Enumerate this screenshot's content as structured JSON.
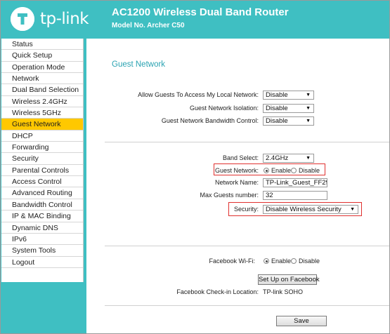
{
  "header": {
    "logo_text": "tp-link",
    "title": "AC1200 Wireless Dual Band Router",
    "model": "Model No. Archer C50"
  },
  "sidebar": {
    "items": [
      {
        "label": "Status"
      },
      {
        "label": "Quick Setup"
      },
      {
        "label": "Operation Mode"
      },
      {
        "label": "Network"
      },
      {
        "label": "Dual Band Selection"
      },
      {
        "label": "Wireless 2.4GHz"
      },
      {
        "label": "Wireless 5GHz"
      },
      {
        "label": "Guest Network",
        "active": true
      },
      {
        "label": "DHCP"
      },
      {
        "label": "Forwarding"
      },
      {
        "label": "Security"
      },
      {
        "label": "Parental Controls"
      },
      {
        "label": "Access Control"
      },
      {
        "label": "Advanced Routing"
      },
      {
        "label": "Bandwidth Control"
      },
      {
        "label": "IP & MAC Binding"
      },
      {
        "label": "Dynamic DNS"
      },
      {
        "label": "IPv6"
      },
      {
        "label": "System Tools"
      },
      {
        "label": "Logout"
      }
    ]
  },
  "main": {
    "section_title": "Guest Network",
    "allow_local": {
      "label": "Allow Guests To Access My Local Network:",
      "value": "Disable"
    },
    "isolation": {
      "label": "Guest Network Isolation:",
      "value": "Disable"
    },
    "bandwidth_control": {
      "label": "Guest Network Bandwidth Control:",
      "value": "Disable"
    },
    "band_select": {
      "label": "Band Select:",
      "value": "2.4GHz"
    },
    "guest_network": {
      "label": "Guest Network:",
      "enable": "Enable",
      "disable": "Disable",
      "selected": "Enable"
    },
    "network_name": {
      "label": "Network Name:",
      "value": "TP-Link_Guest_FF29"
    },
    "max_guests": {
      "label": "Max Guests number:",
      "value": "32"
    },
    "security": {
      "label": "Security:",
      "value": "Disable Wireless Security"
    },
    "facebook_wifi": {
      "label": "Facebook Wi-Fi:",
      "enable": "Enable",
      "disable": "Disable",
      "selected": "Enable"
    },
    "facebook_setup_button": "Set Up on Facebook",
    "checkin": {
      "label": "Facebook Check-in Location:",
      "value": "TP-link SOHO"
    },
    "save_button": "Save"
  },
  "colors": {
    "header_bg": "#3fbfc2",
    "active_nav": "#ffc800",
    "highlight_border": "#e0312f",
    "section_title": "#2aa3b2"
  }
}
